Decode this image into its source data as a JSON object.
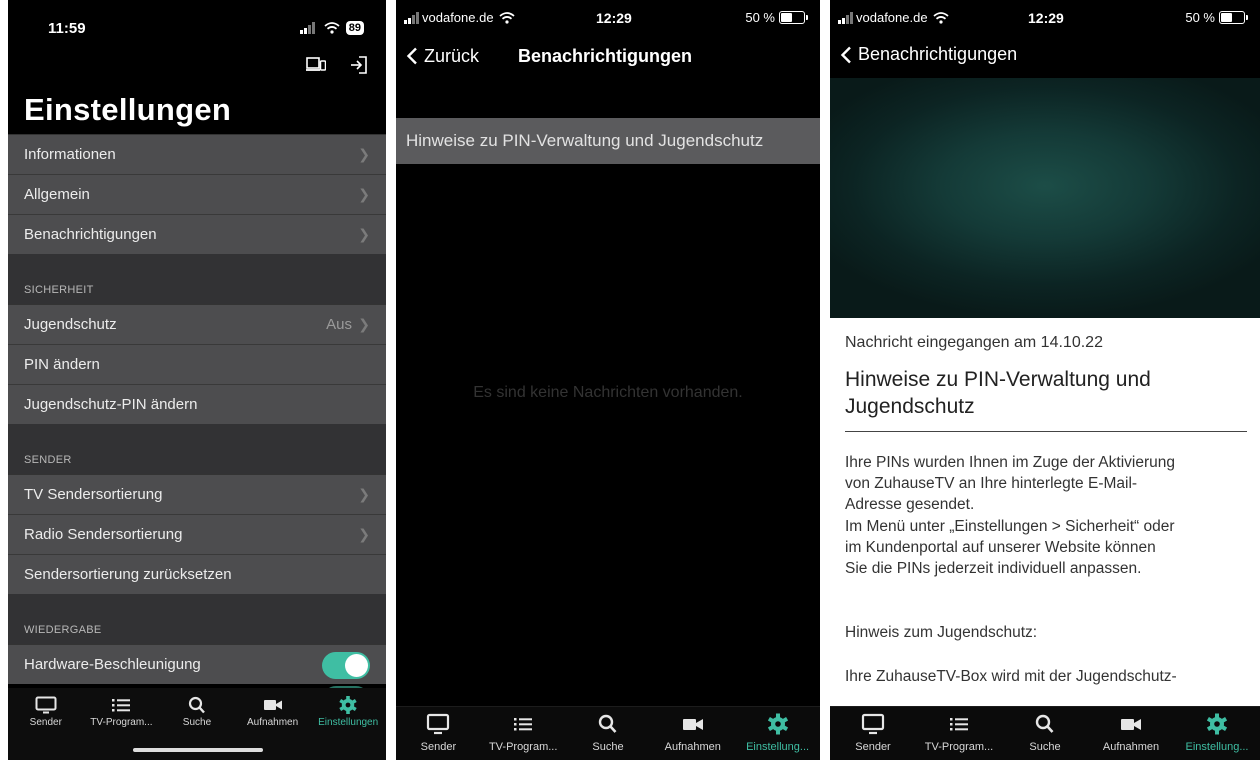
{
  "colors": {
    "accent": "#3fbea3",
    "row_bg": "#4d4d4f",
    "section_bg": "#323234"
  },
  "phone1": {
    "status": {
      "time": "11:59",
      "battery": "89"
    },
    "top_icons": [
      "cast-icon",
      "logout-icon"
    ],
    "title": "Einstellungen",
    "group1": [
      {
        "label": "Informationen"
      },
      {
        "label": "Allgemein"
      },
      {
        "label": "Benachrichtigungen"
      }
    ],
    "section_security": "SICHERHEIT",
    "security": [
      {
        "label": "Jugendschutz",
        "value": "Aus"
      },
      {
        "label": "PIN ändern"
      },
      {
        "label": "Jugendschutz-PIN ändern"
      }
    ],
    "section_sender": "SENDER",
    "sender": [
      {
        "label": "TV Sendersortierung"
      },
      {
        "label": "Radio Sendersortierung"
      },
      {
        "label": "Sendersortierung zurücksetzen"
      }
    ],
    "section_playback": "WIEDERGABE",
    "playback": {
      "label": "Hardware-Beschleunigung",
      "toggle": "on"
    },
    "tabs": [
      "Sender",
      "TV-Program...",
      "Suche",
      "Aufnahmen",
      "Einstellungen"
    ],
    "active_tab": 4
  },
  "phone2": {
    "status": {
      "carrier": "vodafone.de",
      "time": "12:29",
      "battery": "50 %"
    },
    "back_label": "Zurück",
    "title": "Benachrichtigungen",
    "notification": "Hinweise zu PIN-Verwaltung und Jugendschutz",
    "empty": "Es sind keine Nachrichten vorhanden.",
    "tabs": [
      "Sender",
      "TV-Program...",
      "Suche",
      "Aufnahmen",
      "Einstellung..."
    ],
    "active_tab": 4
  },
  "phone3": {
    "status": {
      "carrier": "vodafone.de",
      "time": "12:29",
      "battery": "50 %"
    },
    "back_label": "Benachrichtigungen",
    "date": "Nachricht eingegangen am 14.10.22",
    "title": "Hinweise zu PIN-Verwaltung und Jugendschutz",
    "body_lines": [
      "Ihre PINs wurden Ihnen im Zuge der Aktivierung",
      "von ZuhauseTV an Ihre hinterlegte E-Mail-",
      "Adresse gesendet.",
      "Im Menü unter „Einstellungen > Sicherheit“ oder",
      "im Kundenportal auf unserer Website können",
      "Sie die PINs jederzeit individuell anpassen."
    ],
    "note": "Hinweis zum Jugendschutz:",
    "body2": "Ihre ZuhauseTV-Box wird mit der Jugendschutz-",
    "tabs": [
      "Sender",
      "TV-Program...",
      "Suche",
      "Aufnahmen",
      "Einstellung..."
    ],
    "active_tab": 4
  }
}
